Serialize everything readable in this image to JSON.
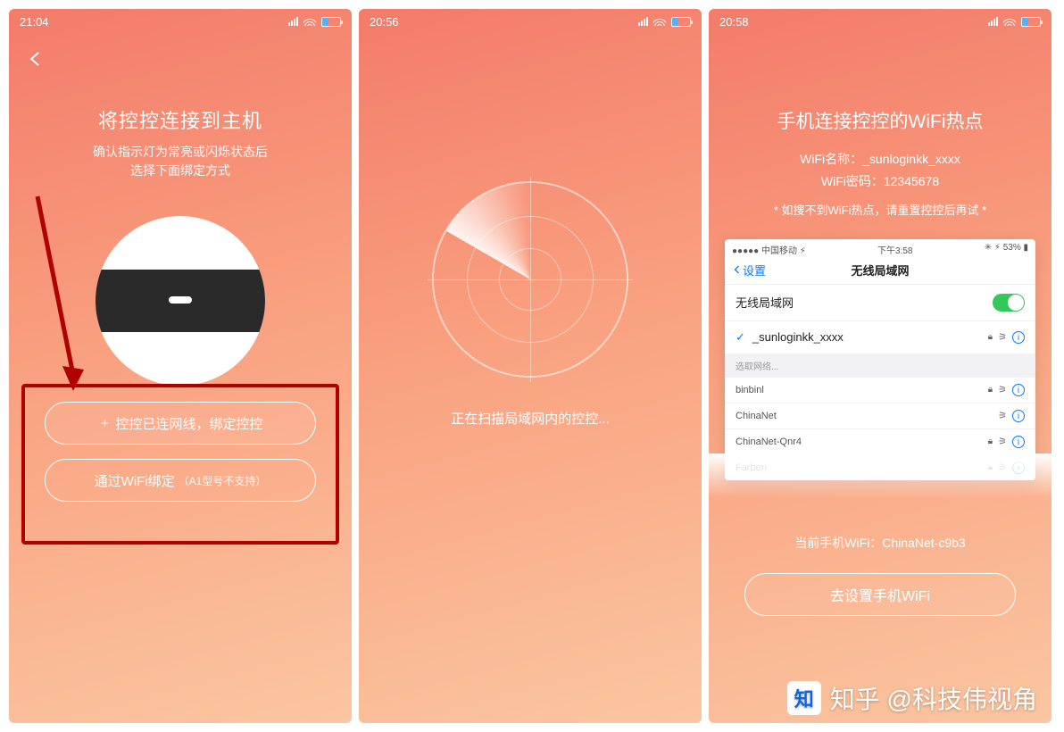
{
  "screens": [
    {
      "time": "21:04",
      "title": "将控控连接到主机",
      "subtitle_l1": "确认指示灯为常亮或闪烁状态后",
      "subtitle_l2": "选择下面绑定方式",
      "btn1": "控控已连网线，绑定控控",
      "btn1_plus": "+",
      "btn2_main": "通过WiFi绑定",
      "btn2_sub": "（A1型号不支持）"
    },
    {
      "time": "20:56",
      "scan_text": "正在扫描局域网内的控控..."
    },
    {
      "time": "20:58",
      "title": "手机连接控控的WiFi热点",
      "wifi_name_line": "WiFi名称：_sunloginkk_xxxx",
      "wifi_pwd_line": "WiFi密码：12345678",
      "note": "* 如搜不到WiFi热点，请重置控控后再试 *",
      "ios": {
        "carrier": "中国移动",
        "clock": "下午3:58",
        "batt": "53%",
        "back": "设置",
        "nav_title": "无线局域网",
        "toggle_label": "无线局域网",
        "connected": "_sunloginkk_xxxx",
        "section": "选取网络...",
        "networks": [
          "binbinl",
          "ChinaNet",
          "ChinaNet-Qnr4",
          "Farben"
        ]
      },
      "current_wifi": "当前手机WiFi：ChinaNet-c9b3",
      "goto_btn": "去设置手机WiFi"
    }
  ],
  "watermark": "知乎 @科技伟视角",
  "watermark_logo": "知"
}
